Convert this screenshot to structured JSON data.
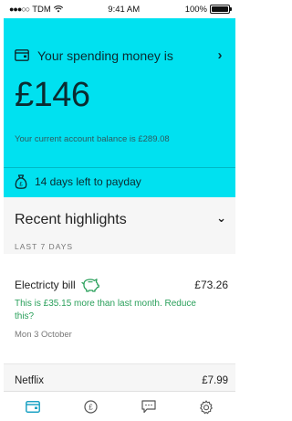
{
  "status_bar": {
    "carrier": "TDM",
    "time": "9:41 AM",
    "battery": "100%"
  },
  "card": {
    "title": "Your spending money is",
    "amount": "£146",
    "balance_text": "Your current account balance is £289.08",
    "payday_text": "14 days left to payday",
    "background_color": "#00e1f0"
  },
  "highlights": {
    "title": "Recent highlights",
    "period": "LAST 7 DAYS",
    "items": [
      {
        "name": "Electricty bill",
        "amount": "£73.26",
        "note": "This is £35.15 more than last month. Reduce this?",
        "date": "Mon 3 October",
        "icon": "piggy-bank-icon"
      },
      {
        "name": "Netflix",
        "amount": "£7.99"
      }
    ]
  },
  "tabbar": {
    "tabs": [
      {
        "icon": "wallet-icon",
        "active": true
      },
      {
        "icon": "pound-coin-icon",
        "active": false
      },
      {
        "icon": "chat-icon",
        "active": false
      },
      {
        "icon": "settings-icon",
        "active": false
      }
    ],
    "active_color": "#1fa3c4"
  }
}
